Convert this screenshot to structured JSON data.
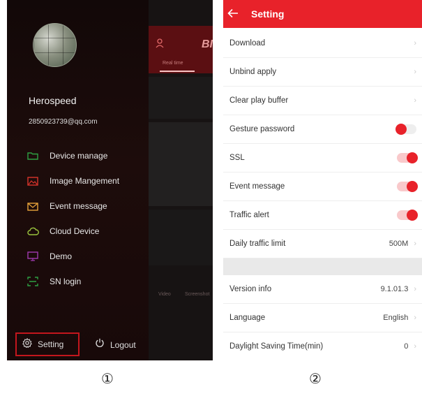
{
  "drawer": {
    "background_preview": {
      "bi_text": "BI",
      "real_time_label": "Real time",
      "video_label": "Video",
      "screenshot_label": "Screenshot"
    },
    "user": {
      "name": "Herospeed",
      "email": "2850923739@qq.com"
    },
    "menu": [
      {
        "label": "Device manage",
        "icon": "folder-icon",
        "color": "#2ea043"
      },
      {
        "label": "Image Mangement",
        "icon": "image-icon",
        "color": "#d9342b"
      },
      {
        "label": "Event message",
        "icon": "envelope-icon",
        "color": "#e9a43a"
      },
      {
        "label": "Cloud Device",
        "icon": "cloud-icon",
        "color": "#9bc53d"
      },
      {
        "label": "Demo",
        "icon": "monitor-icon",
        "color": "#a03ab0"
      },
      {
        "label": "SN login",
        "icon": "scan-icon",
        "color": "#2ea043"
      }
    ],
    "setting_label": "Setting",
    "logout_label": "Logout"
  },
  "settings": {
    "title": "Setting",
    "rows": [
      {
        "label": "Download",
        "type": "link",
        "value": ""
      },
      {
        "label": "Unbind apply",
        "type": "link",
        "value": ""
      },
      {
        "label": "Clear play buffer",
        "type": "link",
        "value": ""
      },
      {
        "label": "Gesture password",
        "type": "toggle",
        "on": false
      },
      {
        "label": "SSL",
        "type": "toggle",
        "on": true
      },
      {
        "label": "Event message",
        "type": "toggle",
        "on": true
      },
      {
        "label": "Traffic alert",
        "type": "toggle",
        "on": true
      },
      {
        "label": "Daily traffic limit",
        "type": "select",
        "value": "500M"
      }
    ],
    "rows2": [
      {
        "label": "Version info",
        "type": "link",
        "value": "9.1.01.3"
      },
      {
        "label": "Language",
        "type": "link",
        "value": "English"
      },
      {
        "label": "Daylight Saving Time(min)",
        "type": "link",
        "value": "0"
      }
    ]
  },
  "markers": {
    "first": "①",
    "second": "②"
  },
  "colors": {
    "accent": "#e8222a",
    "highlight_box": "#c3161d"
  }
}
